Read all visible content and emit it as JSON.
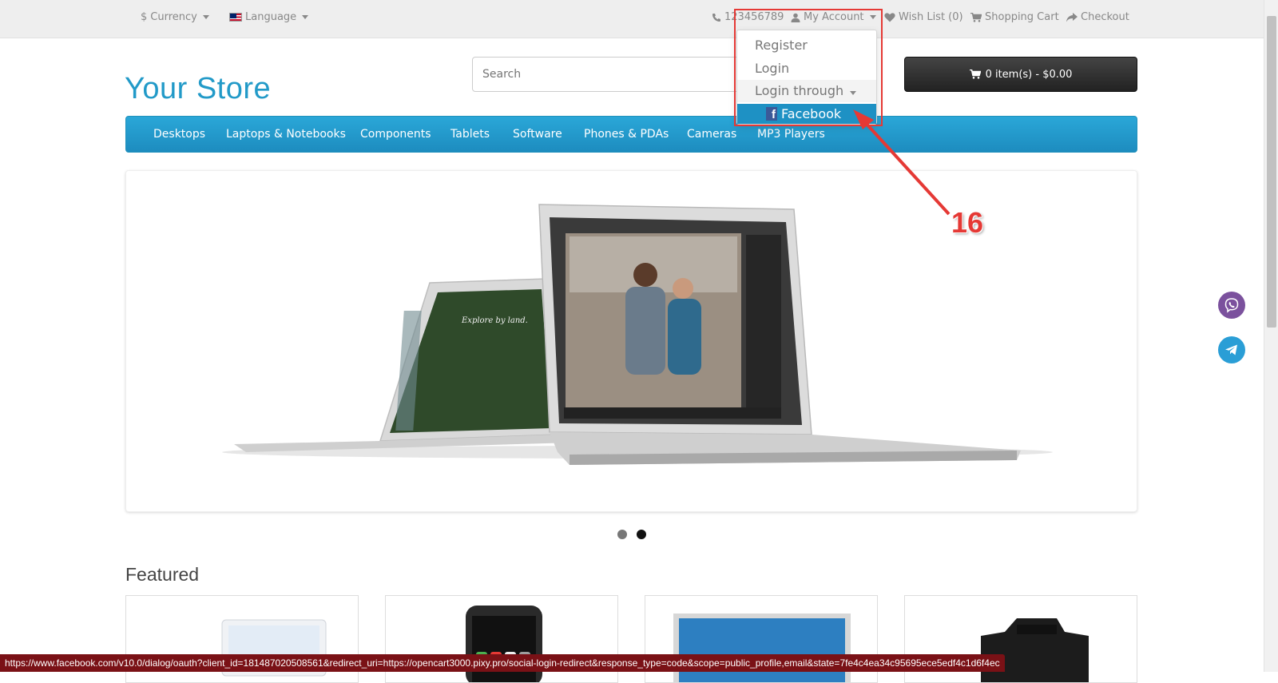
{
  "topbar": {
    "currency_label": "Currency",
    "currency_symbol": "$",
    "language_label": "Language",
    "phone": "123456789",
    "my_account": "My Account",
    "wishlist": "Wish List (0)",
    "shopping_cart": "Shopping Cart",
    "checkout": "Checkout"
  },
  "account_dropdown": {
    "register": "Register",
    "login": "Login",
    "login_through": "Login through",
    "facebook": "Facebook",
    "facebook_glyph": "f"
  },
  "header": {
    "logo": "Your Store",
    "search_placeholder": "Search",
    "cart_button": "0 item(s) - $0.00"
  },
  "menu": {
    "items": [
      "Desktops",
      "Laptops & Notebooks",
      "Components",
      "Tablets",
      "Software",
      "Phones & PDAs",
      "Cameras",
      "MP3 Players"
    ]
  },
  "slideshow": {
    "left_screen_text": "Explore by land."
  },
  "featured": {
    "title": "Featured"
  },
  "annotation": {
    "number": "16"
  },
  "statusbar": {
    "url": "https://www.facebook.com/v10.0/dialog/oauth?client_id=181487020508561&redirect_uri=https://opencart3000.pixy.pro/social-login-redirect&response_type=code&scope=public_profile,email&state=7fe4c4ea34c95695ece5edf4c1d6f4ec"
  },
  "colors": {
    "brand": "#229ac8",
    "menu": "#229ac8",
    "annotation": "#e53935",
    "status_bg": "#7a1116"
  }
}
